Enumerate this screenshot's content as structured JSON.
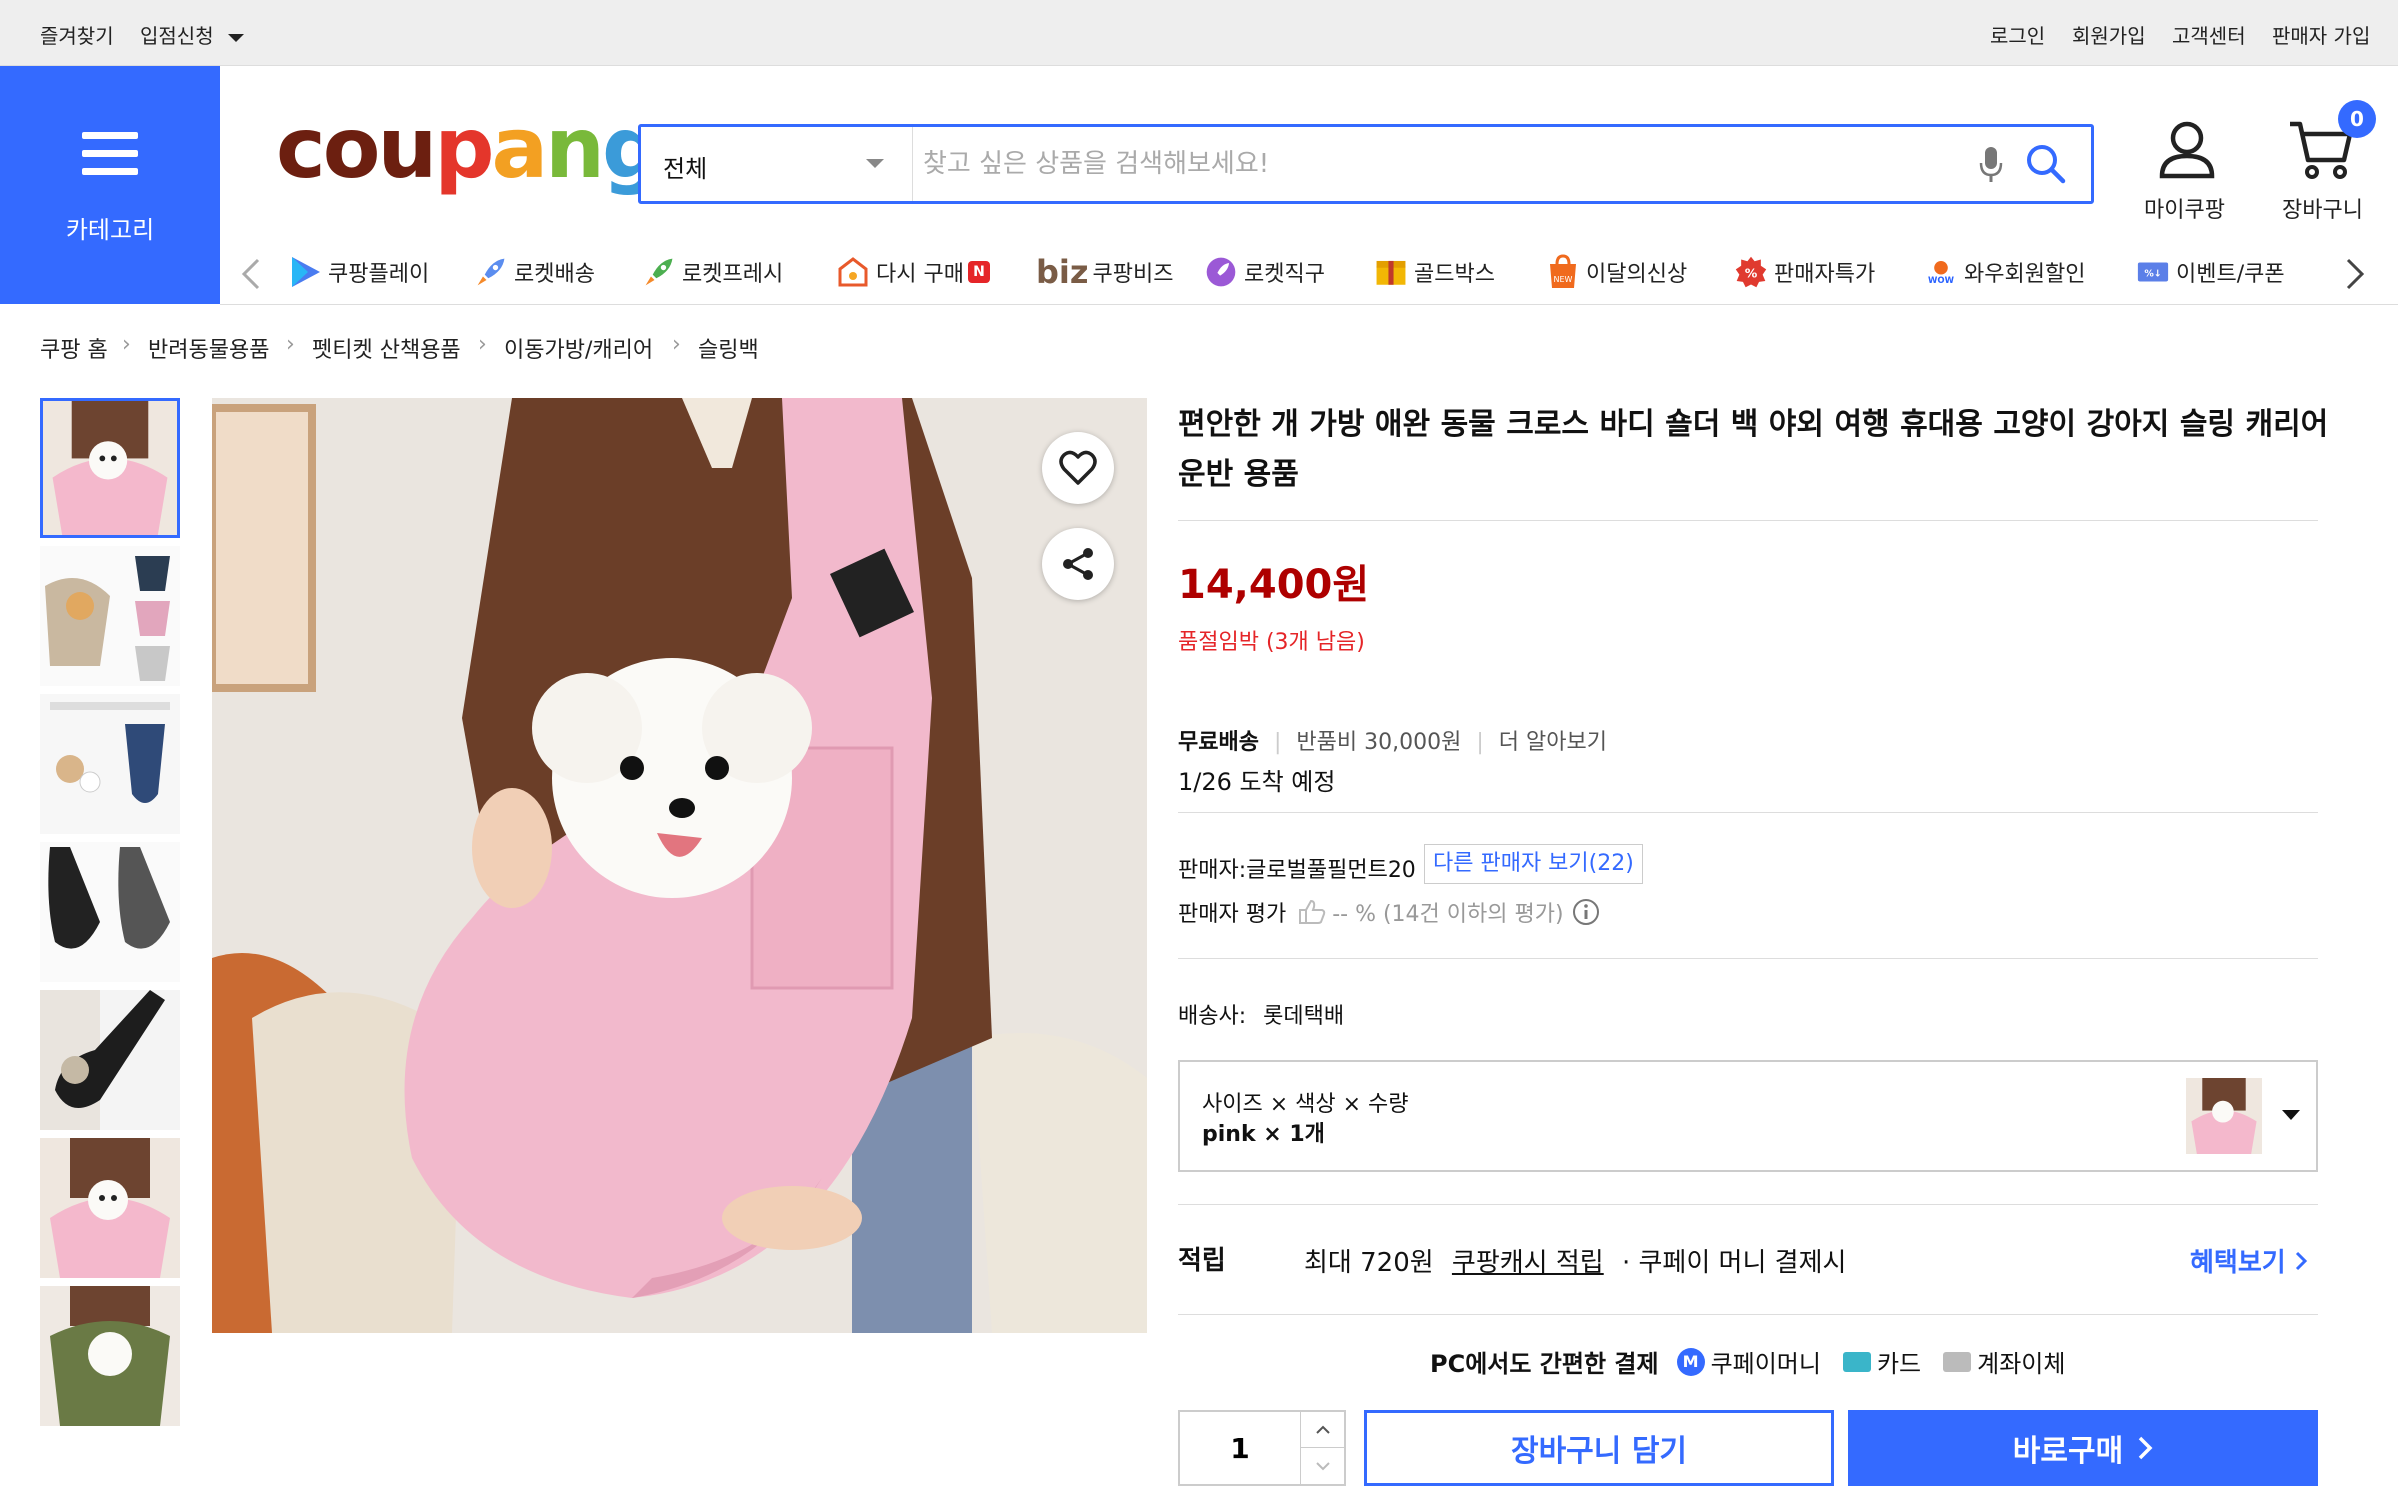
{
  "topbar": {
    "favorites": "즐겨찾기",
    "apply": "입점신청",
    "login": "로그인",
    "signup": "회원가입",
    "customer_center": "고객센터",
    "seller_signup": "판매자 가입"
  },
  "header": {
    "category_label": "카테고리",
    "logo_letters": [
      "c",
      "o",
      "u",
      "p",
      "a",
      "n",
      "g"
    ],
    "logo_colors": [
      "#6c1f10",
      "#6c1f10",
      "#6c1f10",
      "#e4362b",
      "#f3a022",
      "#79b93a",
      "#3b9bd9"
    ],
    "search_category": "전체",
    "search_placeholder": "찾고 싶은 상품을 검색해보세요!",
    "mycoupang_label": "마이쿠팡",
    "cart_label": "장바구니",
    "cart_count": "0"
  },
  "nav": {
    "items": [
      {
        "label": "쿠팡플레이",
        "icon": "play-icon"
      },
      {
        "label": "로켓배송",
        "icon": "rocket-icon"
      },
      {
        "label": "로켓프레시",
        "icon": "rocket-fresh-icon"
      },
      {
        "label": "다시 구매",
        "icon": "rebuy-icon",
        "badge": "N"
      },
      {
        "label": "쿠팡비즈",
        "icon": "biz-icon",
        "prefix": "biz"
      },
      {
        "label": "로켓직구",
        "icon": "rocket-global-icon"
      },
      {
        "label": "골드박스",
        "icon": "goldbox-icon"
      },
      {
        "label": "이달의신상",
        "icon": "new-icon"
      },
      {
        "label": "판매자특가",
        "icon": "seller-deal-icon"
      },
      {
        "label": "와우회원할인",
        "icon": "wow-icon"
      },
      {
        "label": "이벤트/쿠폰",
        "icon": "coupon-icon"
      }
    ]
  },
  "breadcrumb": [
    "쿠팡 홈",
    "반려동물용품",
    "펫티켓 산책용품",
    "이동가방/캐리어",
    "슬링백"
  ],
  "product": {
    "title_line1": "편안한 개 가방 애완 동물 크로스 바디 숄더 백 야외 여행 휴대용 고양이 강아지 슬링 캐리어",
    "title_line2": "운반 용품",
    "price": "14,400원",
    "stock_warning": "품절임박 (3개 남음)",
    "shipping_free": "무료배송",
    "return_fee": "반품비 30,000원",
    "learn_more": "더 알아보기",
    "arrival": "1/26 도착 예정",
    "seller_label": "판매자:글로벌풀필먼트20",
    "other_sellers": "다른 판매자 보기(22)",
    "seller_rating_label": "판매자 평가",
    "seller_rating_value": "-- % (14건 이하의 평가)",
    "carrier_label": "배송사:",
    "carrier_value": "롯데택배",
    "option_header": "사이즈 × 색상 × 수량",
    "option_value": "pink × 1개",
    "reward_label": "적립",
    "reward_max": "최대 720원",
    "reward_cash": "쿠팡캐시 적립",
    "reward_condition": "· 쿠페이 머니 결제시",
    "benefit_link": "혜택보기",
    "pc_pay_label": "PC에서도 간편한 결제",
    "pay_money": "쿠페이머니",
    "pay_card": "카드",
    "pay_account": "계좌이체",
    "quantity": "1",
    "add_to_cart": "장바구니 담기",
    "buy_now": "바로구매"
  },
  "colors": {
    "accent": "#346aff",
    "price": "#ae0000",
    "warning": "#e52528"
  }
}
